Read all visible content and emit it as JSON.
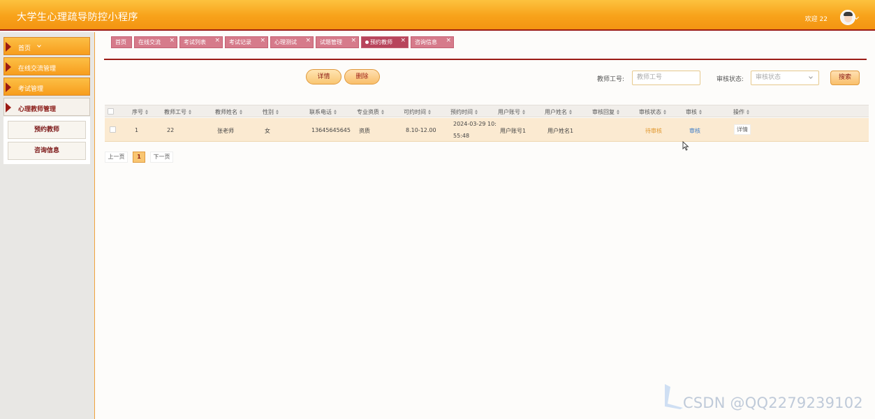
{
  "header": {
    "title": "大学生心理疏导防控小程序",
    "welcome": "欢迎 22"
  },
  "sidebar": {
    "items": [
      {
        "label": "首页"
      },
      {
        "label": "在线交流管理"
      },
      {
        "label": "考试管理"
      },
      {
        "label": "心理教师管理"
      }
    ],
    "sub_items": [
      {
        "label": "预约教师"
      },
      {
        "label": "咨询信息"
      }
    ]
  },
  "tabs": [
    {
      "label": "首页"
    },
    {
      "label": "在线交流"
    },
    {
      "label": "考试列表"
    },
    {
      "label": "考试记录"
    },
    {
      "label": "心理测试"
    },
    {
      "label": "试题管理"
    },
    {
      "label": "预约教师"
    },
    {
      "label": "咨询信息"
    }
  ],
  "tab_close": "×",
  "actions": {
    "detail": "详情",
    "delete": "删除"
  },
  "search": {
    "teacher_id_label": "教师工号:",
    "teacher_id_placeholder": "教师工号",
    "status_label": "审核状态:",
    "status_placeholder": "审核状态",
    "button": "搜索"
  },
  "table": {
    "headers": [
      "序号",
      "教师工号",
      "教师姓名",
      "性别",
      "联系电话",
      "专业资质",
      "可约时间",
      "预约时间",
      "用户账号",
      "用户姓名",
      "审核回复",
      "审核状态",
      "审核",
      "操作"
    ],
    "rows": [
      {
        "index": "1",
        "teacher_id": "22",
        "teacher_name": "张老师",
        "gender": "女",
        "phone": "13645645645",
        "qualification": "资质",
        "available_time": "8.10-12.00",
        "booking_time_1": "2024-03-29 10:",
        "booking_time_2": "55:48",
        "user_account": "用户账号1",
        "user_name": "用户姓名1",
        "reply": "",
        "status": "待审核",
        "audit": "审核",
        "op": "详情"
      }
    ]
  },
  "pagination": {
    "prev": "上一页",
    "current": "1",
    "next": "下一页"
  },
  "watermark": "CSDN @QQ2279239102",
  "colors": {
    "header_orange": "#f8a21a",
    "accent_red": "#9c1c16",
    "tab_pink": "#d67b8b",
    "row_highlight": "#fbead1"
  }
}
